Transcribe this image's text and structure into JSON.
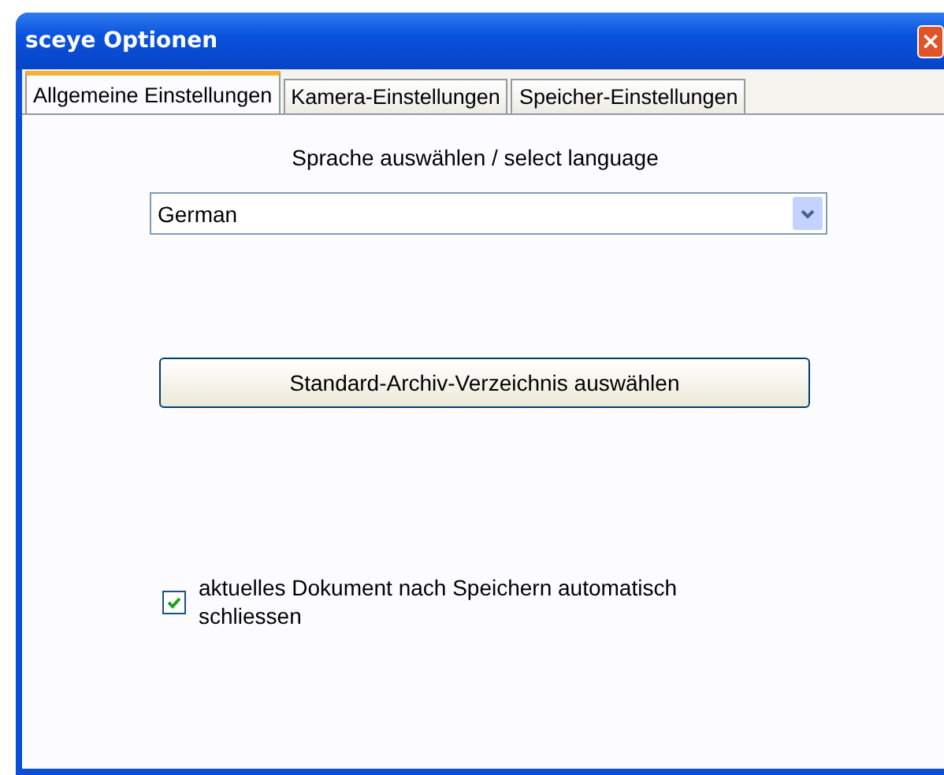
{
  "window": {
    "title": "sceye Optionen",
    "close": "×"
  },
  "tabs": [
    {
      "label": "Allgemeine Einstellungen",
      "selected": true
    },
    {
      "label": "Kamera-Einstellungen",
      "selected": false
    },
    {
      "label": "Speicher-Einstellungen",
      "selected": false
    }
  ],
  "language": {
    "label": "Sprache auswählen / select language",
    "value": "German"
  },
  "archive_button": "Standard-Archiv-Verzeichnis auswählen",
  "auto_close": {
    "label": "aktuelles Dokument nach Speichern automatisch schliessen",
    "checked": true
  }
}
